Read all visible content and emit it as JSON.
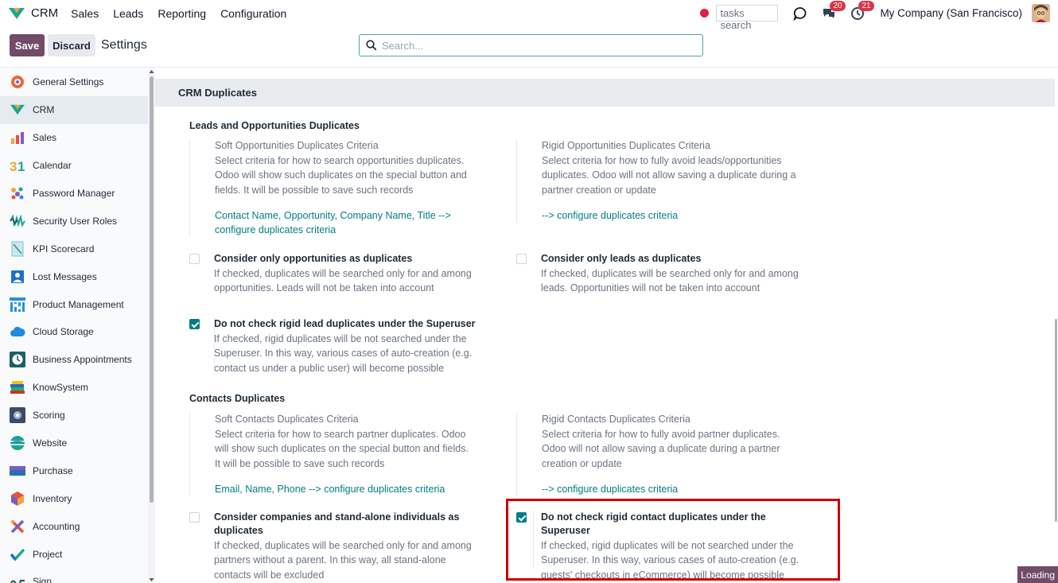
{
  "navbar": {
    "app_name": "CRM",
    "menu": [
      "Sales",
      "Leads",
      "Reporting",
      "Configuration"
    ],
    "tasks_search": "tasks search",
    "messages_count": "20",
    "activities_count": "21",
    "company": "My Company (San Francisco)"
  },
  "control": {
    "save_label": "Save",
    "discard_label": "Discard",
    "title": "Settings",
    "search_placeholder": "Search..."
  },
  "sidebar": {
    "items": [
      {
        "label": "General Settings",
        "icon": "general-settings-icon"
      },
      {
        "label": "CRM",
        "icon": "crm-icon",
        "active": true
      },
      {
        "label": "Sales",
        "icon": "sales-icon"
      },
      {
        "label": "Calendar",
        "icon": "calendar-icon"
      },
      {
        "label": "Password Manager",
        "icon": "password-manager-icon"
      },
      {
        "label": "Security User Roles",
        "icon": "security-user-roles-icon"
      },
      {
        "label": "KPI Scorecard",
        "icon": "kpi-scorecard-icon"
      },
      {
        "label": "Lost Messages",
        "icon": "lost-messages-icon"
      },
      {
        "label": "Product Management",
        "icon": "product-management-icon"
      },
      {
        "label": "Cloud Storage",
        "icon": "cloud-storage-icon"
      },
      {
        "label": "Business Appointments",
        "icon": "business-appointments-icon"
      },
      {
        "label": "KnowSystem",
        "icon": "knowsystem-icon"
      },
      {
        "label": "Scoring",
        "icon": "scoring-icon"
      },
      {
        "label": "Website",
        "icon": "website-icon"
      },
      {
        "label": "Purchase",
        "icon": "purchase-icon"
      },
      {
        "label": "Inventory",
        "icon": "inventory-icon"
      },
      {
        "label": "Accounting",
        "icon": "accounting-icon"
      },
      {
        "label": "Project",
        "icon": "project-icon"
      },
      {
        "label": "Sign",
        "icon": "sign-icon"
      }
    ]
  },
  "main": {
    "section_title": "CRM Duplicates",
    "leads": {
      "title": "Leads and Opportunities Duplicates",
      "soft": {
        "name": "Soft Opportunities Duplicates Criteria",
        "desc": "Select criteria for how to search opportunities duplicates. Odoo will show such duplicates on the special button and fields. It will be possible to save such records",
        "link": "Contact Name, Opportunity, Company Name, Title --> configure duplicates criteria"
      },
      "rigid": {
        "name": "Rigid Opportunities Duplicates Criteria",
        "desc": "Select criteria for how to fully avoid leads/opportunities duplicates. Odoo will not allow saving a duplicate during a partner creation or update",
        "link": "--> configure duplicates criteria"
      },
      "only_opps": {
        "name": "Consider only opportunities as duplicates",
        "desc": "If checked, duplicates will be searched only for and among opportunities. Leads will not be taken into account",
        "checked": false
      },
      "only_leads": {
        "name": "Consider only leads as duplicates",
        "desc": "If checked, duplicates will be searched only for and among leads. Opportunities will not be taken into account",
        "checked": false
      },
      "superuser": {
        "name": "Do not check rigid lead duplicates under the Superuser",
        "desc": "If checked, rigid duplicates will be not searched under the Superuser. In this way, various cases of auto-creation (e.g. contact us under a public user) will become possible",
        "checked": true
      }
    },
    "contacts": {
      "title": "Contacts Duplicates",
      "soft": {
        "name": "Soft Contacts Duplicates Criteria",
        "desc": "Select criteria for how to search partner duplicates. Odoo will show such duplicates on the special button and fields. It will be possible to save such records",
        "link": "Email, Name, Phone --> configure duplicates criteria"
      },
      "rigid": {
        "name": "Rigid Contacts Duplicates Criteria",
        "desc": "Select criteria for how to fully avoid partner duplicates. Odoo will not allow saving a duplicate during a partner creation or update",
        "link": "--> configure duplicates criteria"
      },
      "companies": {
        "name": "Consider companies and stand-alone individuals as duplicates",
        "desc": "If checked, duplicates will be searched only for and among partners without a parent. In this way, all stand-alone contacts will be excluded",
        "checked": false
      },
      "superuser": {
        "name": "Do not check rigid contact duplicates under the Superuser",
        "desc": "If checked, rigid duplicates will be not searched under the Superuser. In this way, various cases of auto-creation (e.g. guests' checkouts in eCommerce) will become possible",
        "checked": true
      }
    }
  },
  "loading_label": "Loading",
  "colors": {
    "brand": "#714b67",
    "link": "#017e84",
    "highlight": "#cc0000"
  }
}
